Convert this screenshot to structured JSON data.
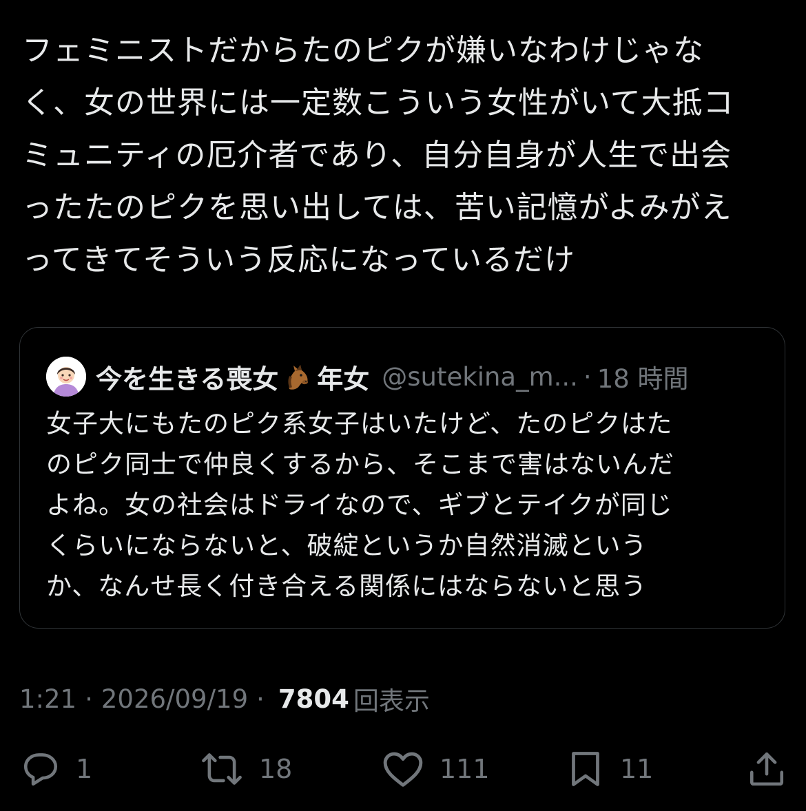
{
  "tweet": {
    "text": "フェミニストだからたのピクが嫌いなわけじゃな\nく、女の世界には一定数こういう女性がいて大抵コ\nミュニティの厄介者であり、自分自身が人生で出会\nったたのピクを思い出しては、苦い記憶がよみがえ\nってきてそういう反応になっているだけ"
  },
  "quote": {
    "name": "今を生きる喪女",
    "emoji": "horse-face-emoji",
    "name_suffix": "年女",
    "handle": "@sutekina_m...",
    "dot": "·",
    "time": "18 時間",
    "text": "女子大にもたのピク系女子はいたけど、たのピクはた\nのピク同士で仲良くするから、そこまで害はないんだ\nよね。女の社会はドライなので、ギブとテイクが同じ\nくらいにならないと、破綻というか自然消滅という\nか、なんせ長く付き合える関係にはならないと思う"
  },
  "meta": {
    "time": "1:21",
    "sep1": "·",
    "date": "2026/09/19",
    "sep2": "·",
    "views_count": "7804",
    "views_label": "回表示"
  },
  "actions": {
    "reply": {
      "icon": "reply-icon",
      "count": "1"
    },
    "retweet": {
      "icon": "retweet-icon",
      "count": "18"
    },
    "like": {
      "icon": "heart-icon",
      "count": "111"
    },
    "bookmark": {
      "icon": "bookmark-icon",
      "count": "11"
    },
    "share": {
      "icon": "share-icon"
    }
  },
  "colors": {
    "background": "#000000",
    "text": "#e7e9ea",
    "secondary": "#71767b",
    "border": "#2f3336"
  }
}
